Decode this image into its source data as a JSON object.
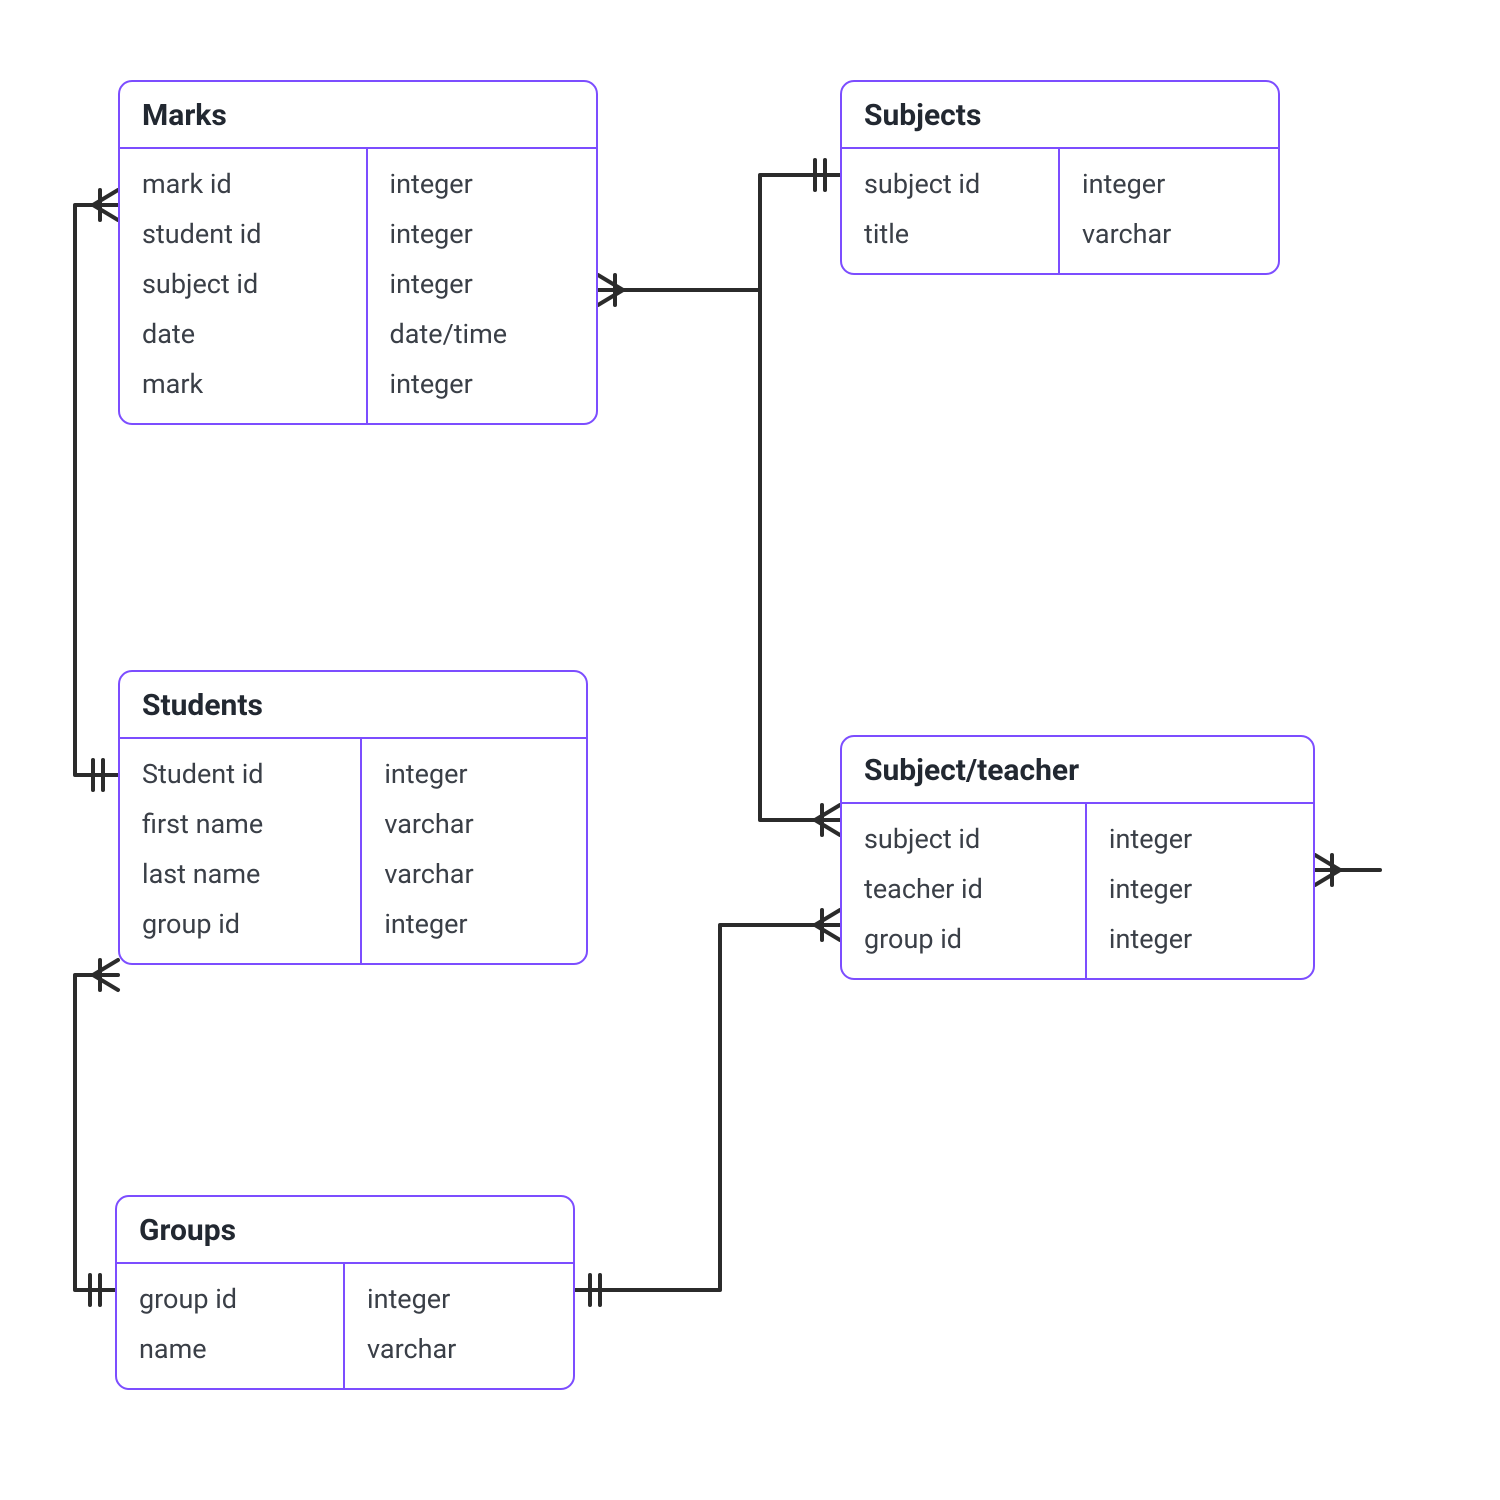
{
  "colors": {
    "border": "#7c4dff",
    "text_heading": "#222831",
    "text_body": "#3a3f47",
    "wire": "#2b2b2b"
  },
  "entities": {
    "marks": {
      "title": "Marks",
      "fields": [
        {
          "name": "mark id",
          "type": "integer"
        },
        {
          "name": "student id",
          "type": "integer"
        },
        {
          "name": "subject id",
          "type": "integer"
        },
        {
          "name": "date",
          "type": "date/time"
        },
        {
          "name": "mark",
          "type": "integer"
        }
      ]
    },
    "subjects": {
      "title": "Subjects",
      "fields": [
        {
          "name": "subject id",
          "type": "integer"
        },
        {
          "name": "title",
          "type": "varchar"
        }
      ]
    },
    "students": {
      "title": "Students",
      "fields": [
        {
          "name": "Student id",
          "type": "integer"
        },
        {
          "name": "first name",
          "type": "varchar"
        },
        {
          "name": "last name",
          "type": "varchar"
        },
        {
          "name": "group id",
          "type": "integer"
        }
      ]
    },
    "subject_teacher": {
      "title": "Subject/teacher",
      "fields": [
        {
          "name": "subject id",
          "type": "integer"
        },
        {
          "name": "teacher id",
          "type": "integer"
        },
        {
          "name": "group id",
          "type": "integer"
        }
      ]
    },
    "groups": {
      "title": "Groups",
      "fields": [
        {
          "name": "group id",
          "type": "integer"
        },
        {
          "name": "name",
          "type": "varchar"
        }
      ]
    }
  },
  "relationships": [
    {
      "from": "students",
      "to": "marks",
      "type": "one-to-many"
    },
    {
      "from": "subjects",
      "to": "marks",
      "type": "one-to-many"
    },
    {
      "from": "subjects",
      "to": "subject_teacher",
      "type": "one-to-many"
    },
    {
      "from": "groups",
      "to": "students",
      "type": "one-to-many"
    },
    {
      "from": "groups",
      "to": "subject_teacher",
      "type": "one-to-many"
    },
    {
      "from": "teachers_ext",
      "to": "subject_teacher",
      "type": "one-to-many"
    }
  ]
}
